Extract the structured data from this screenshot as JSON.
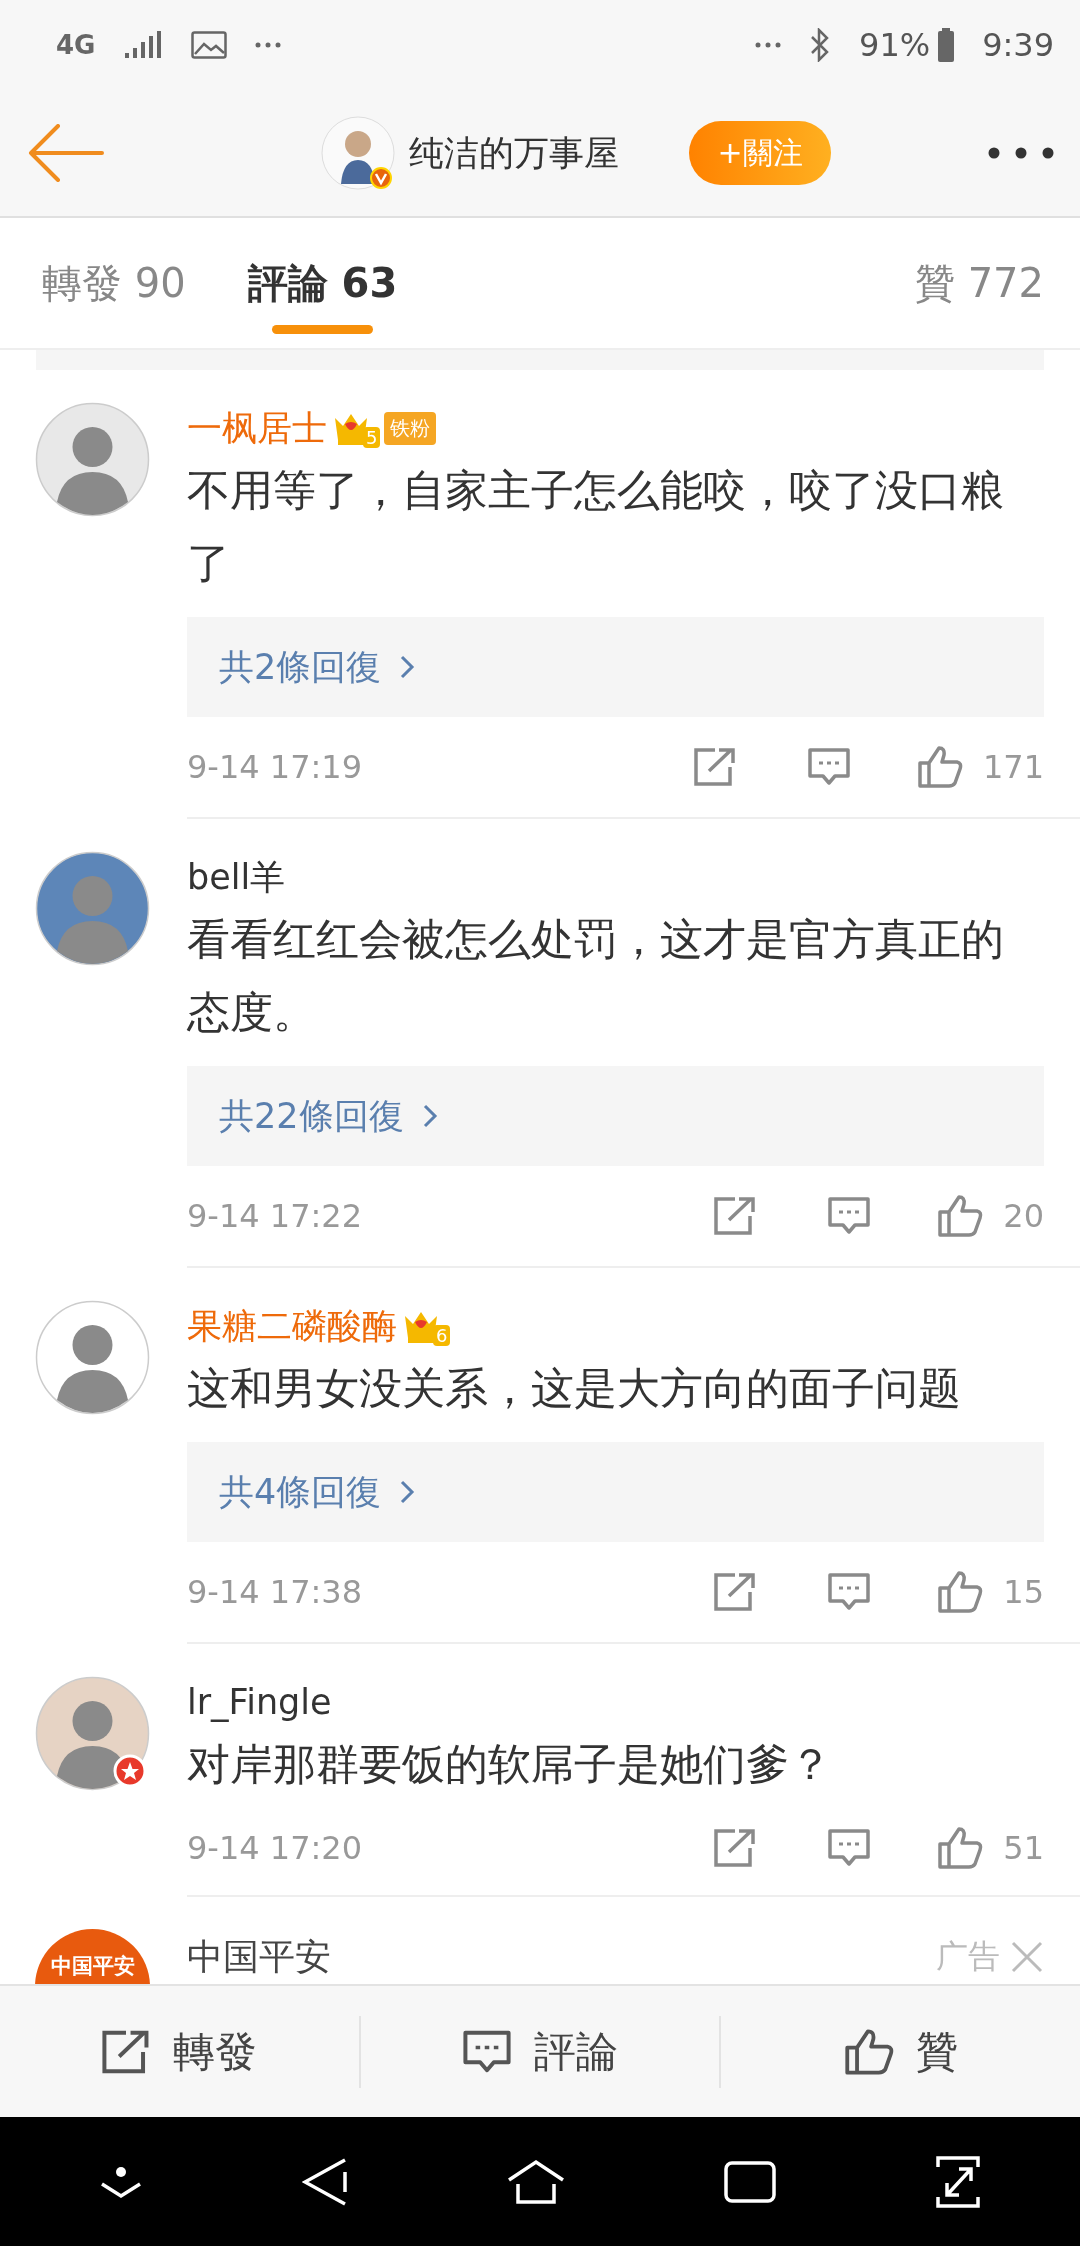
{
  "status_bar": {
    "network": "4G",
    "battery": "91%",
    "time": "9:39"
  },
  "header": {
    "title": "纯洁的万事屋",
    "follow_button": "+關注"
  },
  "tabs": [
    {
      "label": "轉發 90",
      "selected": false
    },
    {
      "label": "評論 63",
      "selected": true
    },
    {
      "label": "贊 772",
      "selected": false
    }
  ],
  "comments": [
    {
      "name": "一枫居士",
      "vip": true,
      "badge": {
        "level": "5",
        "label": "铁粉"
      },
      "text": "不用等了，自家主子怎么能咬，咬了没口粮了",
      "replies": "共2條回復",
      "time": "9-14 17:19",
      "likes": "171",
      "verified": false
    },
    {
      "name": "bell羊",
      "vip": false,
      "text": "看看红红会被怎么处罚，这才是官方真正的态度。",
      "replies": "共22條回復",
      "time": "9-14 17:22",
      "likes": "20",
      "verified": false
    },
    {
      "name": "果糖二磷酸酶",
      "vip": true,
      "badge": {
        "level": "6"
      },
      "text": "这和男女没关系，这是大方向的面子问题",
      "replies": "共4條回復",
      "time": "9-14 17:38",
      "likes": "15",
      "verified": false
    },
    {
      "name": "lr_Fingle",
      "vip": false,
      "text": "对岸那群要饭的软屌子是她们爹？",
      "time": "9-14 17:20",
      "likes": "51",
      "verified": true
    }
  ],
  "ad": {
    "name": "中国平安",
    "logo_text": "中国平安",
    "tag": "广告"
  },
  "action_bar": [
    {
      "kind": "repost",
      "label": "轉發"
    },
    {
      "kind": "comment",
      "label": "評論"
    },
    {
      "kind": "like",
      "label": "贊"
    }
  ]
}
